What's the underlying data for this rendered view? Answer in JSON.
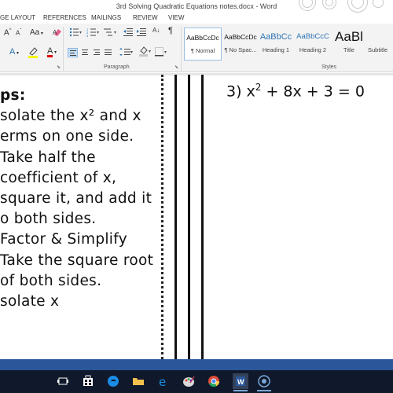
{
  "window": {
    "title": "3rd Solving Quadratic Equations notes.docx - Word"
  },
  "ribbon_tabs": [
    {
      "label": "GE LAYOUT"
    },
    {
      "label": "REFERENCES"
    },
    {
      "label": "MAILINGS"
    },
    {
      "label": "REVIEW"
    },
    {
      "label": "VIEW"
    }
  ],
  "font_group": {
    "grow_label": "A",
    "shrink_label": "A",
    "case_label": "Aa",
    "highlight_label": "A",
    "color_label": "A"
  },
  "paragraph_group": {
    "label": "Paragraph",
    "sort_label": "A↓",
    "pilcrow_label": "¶"
  },
  "styles_group": {
    "label": "Styles",
    "styles": [
      {
        "sample": "AaBbCcDc",
        "name": "¶ Normal"
      },
      {
        "sample": "AaBbCcDc",
        "name": "¶ No Spac..."
      },
      {
        "sample": "AaBbCc",
        "name": "Heading 1"
      },
      {
        "sample": "AaBbCcC",
        "name": "Heading 2"
      },
      {
        "sample": "AaBl",
        "name": "Title"
      },
      {
        "sample": "",
        "name": "Subtitle"
      }
    ]
  },
  "document": {
    "steps": [
      "ps:",
      "solate the x² and x",
      "erms on one side.",
      "Take half the",
      "coefficient of x,",
      "square it, and add it",
      "o both sides.",
      "Factor & Simplify",
      "Take the square root",
      "of both sides.",
      "solate x"
    ],
    "equation": {
      "prefix": "3) x",
      "exponent": "2",
      "rest": " + 8x + 3 = 0"
    }
  },
  "colors": {
    "word_blue": "#2b579a",
    "taskbar": "#10192b",
    "ribbon_bg": "#f3f3f3",
    "heading_blue": "#2e74b5"
  },
  "taskbar_icons": [
    "task-view-icon",
    "store-icon",
    "edge-icon",
    "paint-icon",
    "chrome-icon",
    "word-icon",
    "record-icon"
  ]
}
